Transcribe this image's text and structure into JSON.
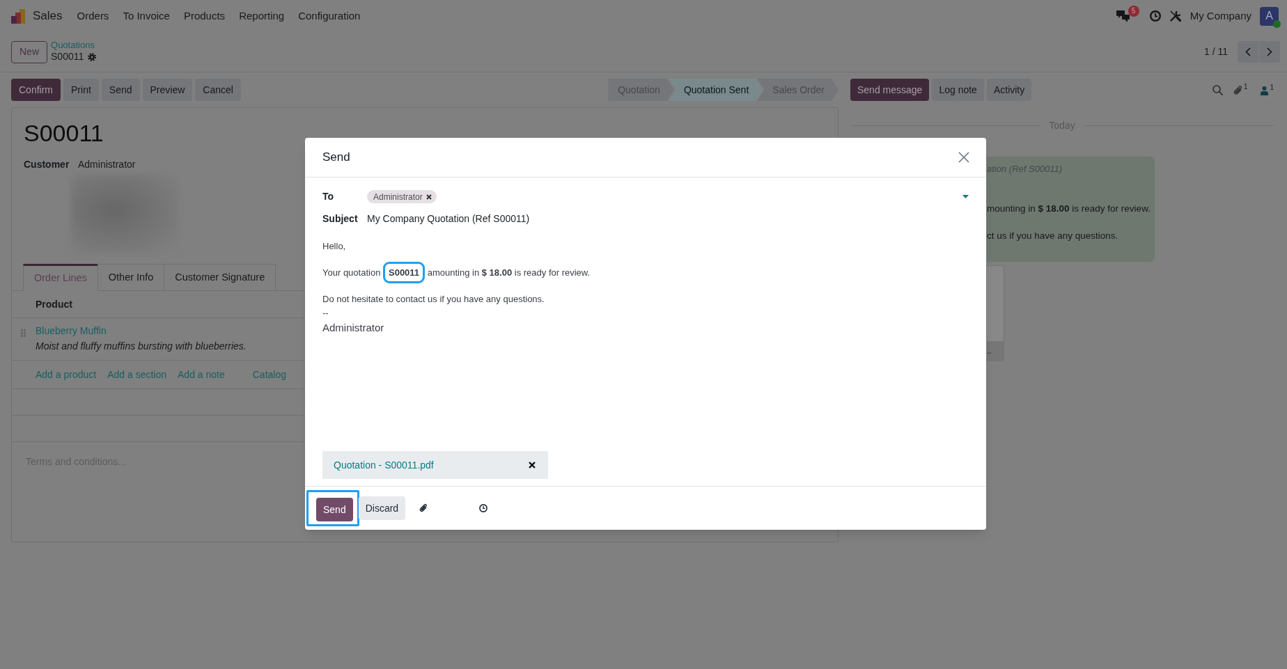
{
  "navbar": {
    "app": "Sales",
    "menu": [
      "Orders",
      "To Invoice",
      "Products",
      "Reporting",
      "Configuration"
    ],
    "message_count": "5",
    "company": "My Company",
    "avatar": {
      "letter": "A",
      "online": true
    }
  },
  "control_panel": {
    "new_button": "New",
    "breadcrumb": "Quotations",
    "record": "S00011",
    "pager": "1 / 11"
  },
  "actions": [
    {
      "label": "Confirm",
      "kind": "primary"
    },
    {
      "label": "Print",
      "kind": "secondary"
    },
    {
      "label": "Send",
      "kind": "secondary"
    },
    {
      "label": "Preview",
      "kind": "secondary"
    },
    {
      "label": "Cancel",
      "kind": "secondary"
    }
  ],
  "status_steps": [
    {
      "label": "Quotation",
      "selected": false
    },
    {
      "label": "Quotation Sent",
      "selected": true
    },
    {
      "label": "Sales Order",
      "selected": false
    }
  ],
  "chatter_actions": [
    {
      "label": "Send message",
      "kind": "primary"
    },
    {
      "label": "Log note",
      "kind": "secondary"
    },
    {
      "label": "Activity",
      "kind": "secondary"
    }
  ],
  "chatter_counters": {
    "attachments": "1",
    "followers": "1"
  },
  "form": {
    "title": "S00011",
    "customer_label": "Customer",
    "customer": "Administrator",
    "tabs": [
      {
        "label": "Order Lines",
        "selected": true
      },
      {
        "label": "Other Info",
        "selected": false
      },
      {
        "label": "Customer Signature",
        "selected": false
      }
    ],
    "column": "Product",
    "lines": [
      {
        "product": "Blueberry Muffin",
        "description": "Moist and fluffy muffins bursting with blueberries."
      }
    ],
    "add_links": [
      "Add a product",
      "Add a section",
      "Add a note"
    ],
    "catalog_link": "Catalog",
    "terms": {
      "placeholder": "Terms and conditions..."
    }
  },
  "chatter": {
    "date": "Today",
    "message_lines": [
      {
        "text": "ation (Ref S00011)",
        "kind": "subject"
      },
      {
        "text": "mounting in **$ 18.00** is ready for review.",
        "kind": "body"
      },
      {
        "text": "ct us if you have any questions.",
        "kind": "body"
      }
    ],
    "attachment_caption": ".."
  },
  "dialog": {
    "title": "Send",
    "to_label": "To",
    "recipients": [
      "Administrator"
    ],
    "subject_label": "Subject",
    "subject": "My Company Quotation (Ref S00011)",
    "paragraphs": [
      {
        "text": "Hello,",
        "highlighted": false
      },
      {
        "text": "Your quotation **S00011** amounting in **$ 18.00** is ready for review.",
        "highlighted": true
      },
      {
        "text": "Do not hesitate to contact us if you have any questions.",
        "highlighted": false
      }
    ],
    "signature_separator": "--",
    "signature": "Administrator",
    "attachment": "Quotation - S00011.pdf",
    "buttons": [
      {
        "label": "Send",
        "kind": "primary",
        "highlighted": true
      },
      {
        "label": "Discard",
        "kind": "secondary",
        "highlighted": false
      }
    ]
  }
}
